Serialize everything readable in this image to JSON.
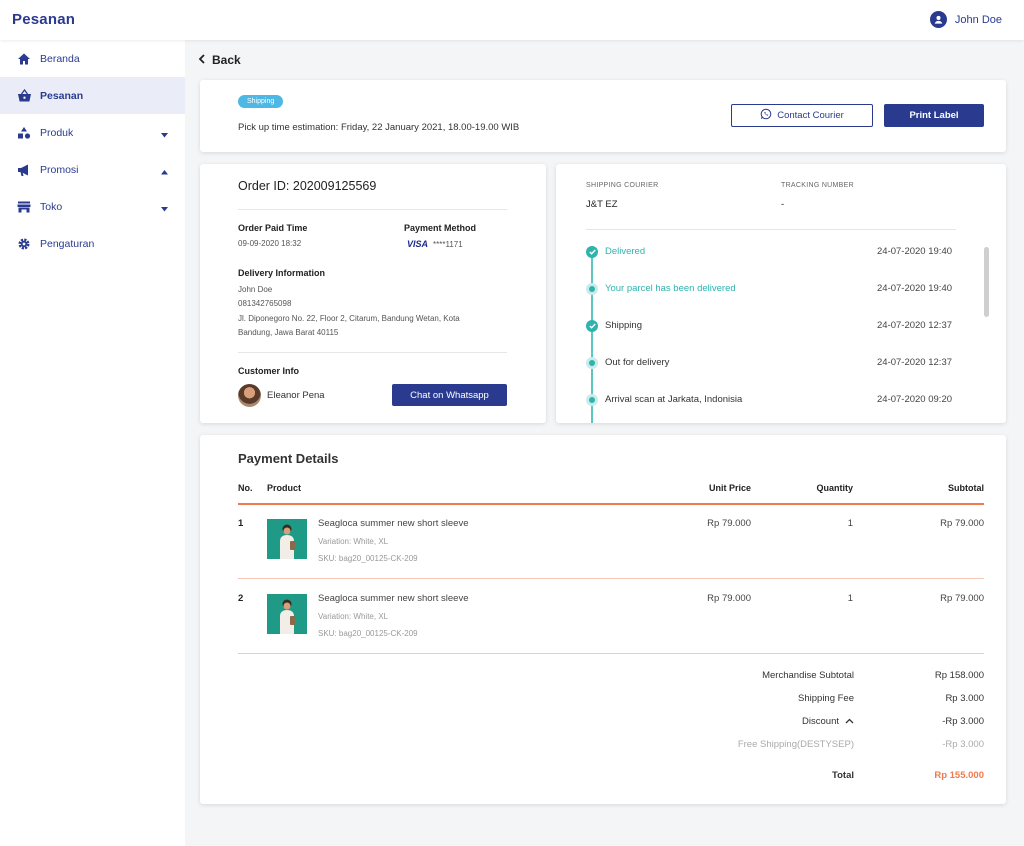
{
  "header": {
    "title": "Pesanan",
    "user_name": "John Doe"
  },
  "sidebar": {
    "items": [
      {
        "label": "Beranda"
      },
      {
        "label": "Pesanan"
      },
      {
        "label": "Produk"
      },
      {
        "label": "Promosi"
      },
      {
        "label": "Toko"
      },
      {
        "label": "Pengaturan"
      }
    ]
  },
  "back_label": "Back",
  "status": {
    "badge": "Shipping",
    "pickup": "Pick up time estimation: Friday, 22 January 2021, 18.00-19.00 WIB",
    "contact_courier": "Contact Courier",
    "print_label": "Print Label"
  },
  "order": {
    "id_label": "Order ID: 202009125569",
    "paid_time_label": "Order Paid Time",
    "paid_time": "09-09-2020 18:32",
    "payment_method_label": "Payment Method",
    "card_brand": "VISA",
    "card_number": "****1171",
    "delivery_label": "Delivery Information",
    "delivery_name": "John Doe",
    "delivery_phone": "081342765098",
    "delivery_address_1": "Jl. Diponegoro No. 22, Floor 2, Citarum, Bandung Wetan, Kota",
    "delivery_address_2": "Bandung, Jawa Barat 40115",
    "customer_label": "Customer Info",
    "customer_name": "Eleanor Pena",
    "chat_button": "Chat on Whatsapp"
  },
  "shipping": {
    "courier_label": "SHIPPING COURIER",
    "courier": "J&T EZ",
    "tracking_label": "TRACKING NUMBER",
    "tracking": "-",
    "timeline": [
      {
        "text": "Delivered",
        "time": "24-07-2020 19:40",
        "state": "check",
        "highlight": true
      },
      {
        "text": "Your parcel has been delivered",
        "time": "24-07-2020 19:40",
        "state": "ring",
        "highlight": true
      },
      {
        "text": "Shipping",
        "time": "24-07-2020 12:37",
        "state": "check",
        "highlight": false
      },
      {
        "text": "Out for delivery",
        "time": "24-07-2020 12:37",
        "state": "ring",
        "highlight": false
      },
      {
        "text": "Arrival scan at Jarkata, Indonisia",
        "time": "24-07-2020 09:20",
        "state": "ring",
        "highlight": false
      }
    ]
  },
  "payment": {
    "title": "Payment Details",
    "columns": {
      "no": "No.",
      "product": "Product",
      "unit_price": "Unit Price",
      "quantity": "Quantity",
      "subtotal": "Subtotal"
    },
    "items": [
      {
        "no": "1",
        "name": "Seagloca summer new short sleeve",
        "variation": "Variation: White, XL",
        "sku": "SKU: bag20_00125-CK-209",
        "unit_price": "Rp 79.000",
        "quantity": "1",
        "subtotal": "Rp 79.000"
      },
      {
        "no": "2",
        "name": "Seagloca summer new short sleeve",
        "variation": "Variation: White, XL",
        "sku": "SKU: bag20_00125-CK-209",
        "unit_price": "Rp 79.000",
        "quantity": "1",
        "subtotal": "Rp 79.000"
      }
    ],
    "summary": {
      "merch_label": "Merchandise Subtotal",
      "merch": "Rp 158.000",
      "ship_label": "Shipping Fee",
      "ship": "Rp 3.000",
      "discount_label": "Discount",
      "discount": "-Rp 3.000",
      "free_ship_label": "Free Shipping(DESTYSEP)",
      "free_ship": "-Rp 3.000",
      "total_label": "Total",
      "total": "Rp 155.000"
    }
  },
  "colors": {
    "primary": "#2a3b8f",
    "teal": "#2fb3ad",
    "accent_orange": "#f07a4f",
    "badge_blue": "#4db8e6"
  }
}
